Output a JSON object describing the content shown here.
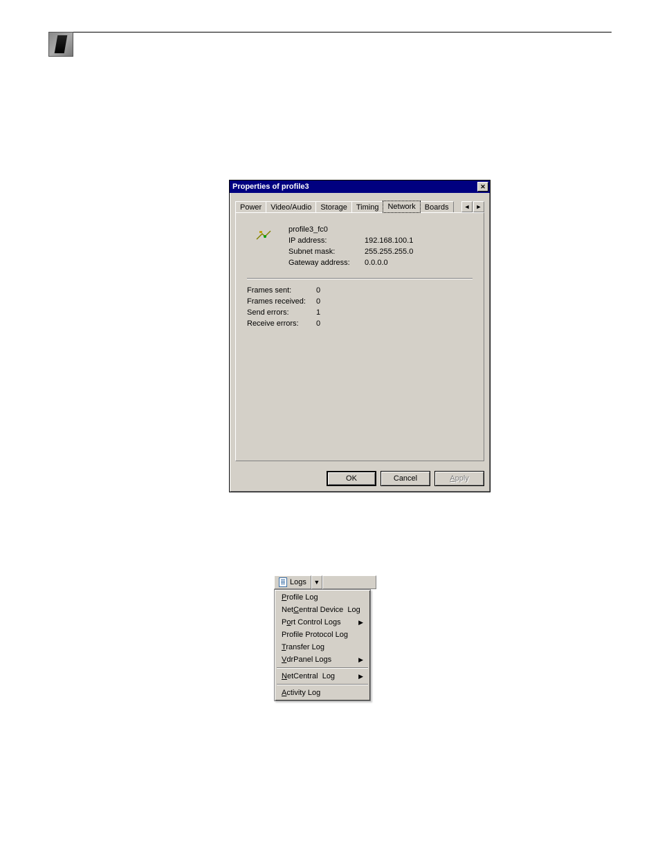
{
  "dialog": {
    "title": "Properties of profile3",
    "tabs": [
      "Power",
      "Video/Audio",
      "Storage",
      "Timing",
      "Network",
      "Boards"
    ],
    "active_tab": "Network",
    "network": {
      "name": "profile3_fc0",
      "fields": [
        {
          "label": "IP address:",
          "value": "192.168.100.1"
        },
        {
          "label": "Subnet mask:",
          "value": "255.255.255.0"
        },
        {
          "label": "Gateway address:",
          "value": "0.0.0.0"
        }
      ],
      "stats": [
        {
          "label": "Frames sent:",
          "value": "0"
        },
        {
          "label": "Frames received:",
          "value": "0"
        },
        {
          "label": "Send errors:",
          "value": "1"
        },
        {
          "label": "Receive errors:",
          "value": "0"
        }
      ]
    },
    "buttons": {
      "ok": "OK",
      "cancel": "Cancel",
      "apply": "Apply"
    }
  },
  "logs_menu": {
    "button_label": "Logs",
    "items": [
      {
        "label": "Profile Log",
        "mnemonic": "P",
        "submenu": false
      },
      {
        "label": "NetCentral Device  Log",
        "mnemonic": "C",
        "submenu": false
      },
      {
        "label": "Port Control Logs",
        "mnemonic": "o",
        "submenu": true
      },
      {
        "label": "Profile Protocol Log",
        "mnemonic": "",
        "submenu": false
      },
      {
        "label": "Transfer Log",
        "mnemonic": "T",
        "submenu": false
      },
      {
        "label": "VdrPanel Logs",
        "mnemonic": "V",
        "submenu": true
      }
    ],
    "sep1": [
      {
        "label": "NetCentral  Log",
        "mnemonic": "N",
        "submenu": true
      }
    ],
    "sep2": [
      {
        "label": "Activity Log",
        "mnemonic": "A",
        "submenu": false
      }
    ]
  }
}
